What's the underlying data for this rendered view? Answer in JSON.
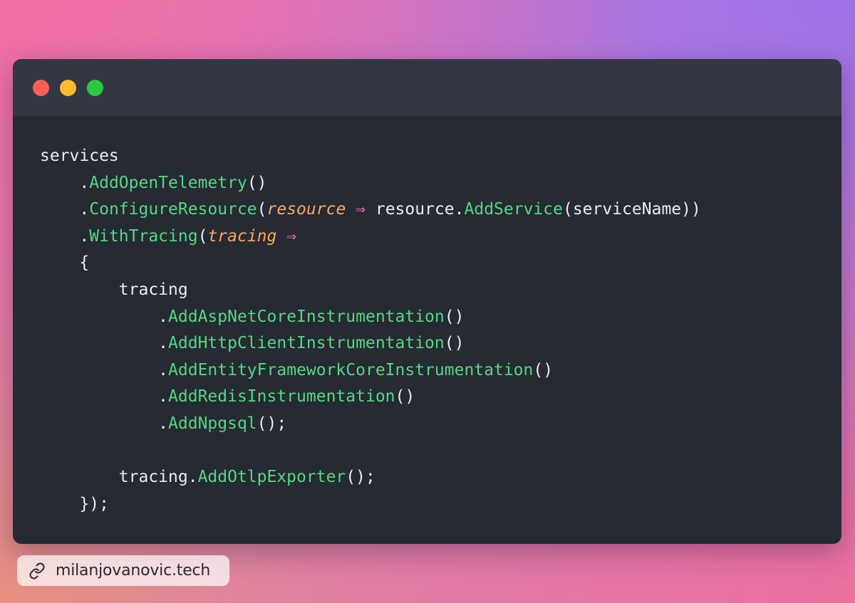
{
  "colors": {
    "close": "#fe5f57",
    "minimize": "#febb2e",
    "maximize": "#29c940",
    "method": "#53d883",
    "parameter": "#f6a963",
    "arrow_operator": "#e96fc7",
    "text": "#e9ecf2",
    "editor_background": "#262a33",
    "titlebar_background": "#333743"
  },
  "code": {
    "lines": [
      {
        "indent": "",
        "parts": [
          {
            "t": "services"
          }
        ]
      },
      {
        "indent": "    ",
        "parts": [
          {
            "t": "."
          },
          {
            "t": "AddOpenTelemetry",
            "c": "fn"
          },
          {
            "t": "()"
          }
        ]
      },
      {
        "indent": "    ",
        "parts": [
          {
            "t": "."
          },
          {
            "t": "ConfigureResource",
            "c": "fn"
          },
          {
            "t": "("
          },
          {
            "t": "resource",
            "c": "param"
          },
          {
            "t": " "
          },
          {
            "t": "⇒",
            "c": "op"
          },
          {
            "t": " resource."
          },
          {
            "t": "AddService",
            "c": "fn"
          },
          {
            "t": "(serviceName))"
          }
        ]
      },
      {
        "indent": "    ",
        "parts": [
          {
            "t": "."
          },
          {
            "t": "WithTracing",
            "c": "fn"
          },
          {
            "t": "("
          },
          {
            "t": "tracing",
            "c": "param"
          },
          {
            "t": " "
          },
          {
            "t": "⇒",
            "c": "op"
          }
        ]
      },
      {
        "indent": "    ",
        "parts": [
          {
            "t": "{"
          }
        ]
      },
      {
        "indent": "        ",
        "parts": [
          {
            "t": "tracing"
          }
        ]
      },
      {
        "indent": "            ",
        "parts": [
          {
            "t": "."
          },
          {
            "t": "AddAspNetCoreInstrumentation",
            "c": "fn"
          },
          {
            "t": "()"
          }
        ]
      },
      {
        "indent": "            ",
        "parts": [
          {
            "t": "."
          },
          {
            "t": "AddHttpClientInstrumentation",
            "c": "fn"
          },
          {
            "t": "()"
          }
        ]
      },
      {
        "indent": "            ",
        "parts": [
          {
            "t": "."
          },
          {
            "t": "AddEntityFrameworkCoreInstrumentation",
            "c": "fn"
          },
          {
            "t": "()"
          }
        ]
      },
      {
        "indent": "            ",
        "parts": [
          {
            "t": "."
          },
          {
            "t": "AddRedisInstrumentation",
            "c": "fn"
          },
          {
            "t": "()"
          }
        ]
      },
      {
        "indent": "            ",
        "parts": [
          {
            "t": "."
          },
          {
            "t": "AddNpgsql",
            "c": "fn"
          },
          {
            "t": "();"
          }
        ]
      },
      {
        "indent": "",
        "parts": [
          {
            "t": ""
          }
        ]
      },
      {
        "indent": "        ",
        "parts": [
          {
            "t": "tracing."
          },
          {
            "t": "AddOtlpExporter",
            "c": "fn"
          },
          {
            "t": "();"
          }
        ]
      },
      {
        "indent": "    ",
        "parts": [
          {
            "t": "});"
          }
        ]
      }
    ]
  },
  "footer": {
    "icon": "link-icon",
    "text": "milanjovanovic.tech"
  }
}
